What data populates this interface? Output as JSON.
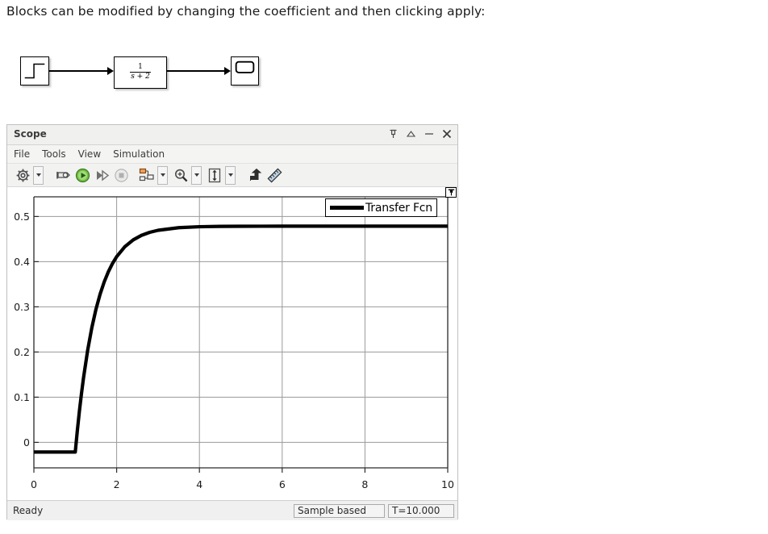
{
  "page": {
    "heading": "Blocks can be modified by changing the coefficient and then clicking apply:"
  },
  "model": {
    "step_block_name": "step-block",
    "transfer_fcn": {
      "numerator": "1",
      "denominator": "s + 2"
    },
    "scope_block_name": "scope-block"
  },
  "scope": {
    "title": "Scope",
    "window_controls": [
      {
        "name": "pin",
        "glyph": "⍠"
      },
      {
        "name": "undock",
        "glyph": "△"
      },
      {
        "name": "minimize",
        "glyph": "−"
      },
      {
        "name": "close",
        "glyph": "✕"
      }
    ],
    "menu": [
      {
        "label": "File"
      },
      {
        "label": "Tools"
      },
      {
        "label": "View"
      },
      {
        "label": "Simulation"
      }
    ],
    "toolbar": [
      {
        "name": "configuration-properties-icon",
        "has_dropdown": true
      },
      {
        "name": "print-icon",
        "has_dropdown": false
      },
      {
        "name": "run-icon",
        "has_dropdown": false
      },
      {
        "name": "step-forward-icon",
        "has_dropdown": false
      },
      {
        "name": "stop-icon",
        "has_dropdown": false
      },
      {
        "name": "layout-icon",
        "has_dropdown": true
      },
      {
        "name": "zoom-in-icon",
        "has_dropdown": true
      },
      {
        "name": "autoscale-icon",
        "has_dropdown": true
      },
      {
        "name": "bring-to-front-icon",
        "has_dropdown": false
      },
      {
        "name": "measurements-icon",
        "has_dropdown": false
      }
    ],
    "plot_pin_label": "⍠",
    "legend": {
      "label": "Transfer Fcn",
      "color": "#000000"
    },
    "statusbar": {
      "status": "Ready",
      "mode": "Sample based",
      "time": "T=10.000"
    }
  },
  "chart_data": {
    "type": "line",
    "title": "",
    "xlabel": "",
    "ylabel": "",
    "xlim": [
      0,
      10
    ],
    "ylim": [
      -0.035,
      0.565
    ],
    "xticks": [
      0,
      2,
      4,
      6,
      8,
      10
    ],
    "yticks": [
      0,
      0.1,
      0.2,
      0.3,
      0.4,
      0.5
    ],
    "xticklabels": [
      "0",
      "2",
      "4",
      "6",
      "8",
      "10"
    ],
    "yticklabels": [
      "0",
      "0.1",
      "0.2",
      "0.3",
      "0.4",
      "0.5"
    ],
    "grid": true,
    "legend_position": "upper right",
    "series": [
      {
        "name": "Transfer Fcn",
        "color": "#000000",
        "linewidth": 3,
        "x": [
          0,
          0.2,
          0.4,
          0.6,
          0.8,
          1.0,
          1.05,
          1.1,
          1.15,
          1.2,
          1.3,
          1.4,
          1.5,
          1.6,
          1.7,
          1.8,
          1.9,
          2.0,
          2.2,
          2.4,
          2.6,
          2.8,
          3.0,
          3.5,
          4.0,
          4.5,
          5.0,
          5.5,
          6.0,
          6.5,
          7.0,
          7.5,
          8.0,
          8.5,
          9.0,
          9.5,
          10.0
        ],
        "y": [
          0,
          0,
          0,
          0,
          0,
          0,
          0.0476,
          0.0906,
          0.1295,
          0.1648,
          0.2256,
          0.2753,
          0.3161,
          0.3495,
          0.3768,
          0.3992,
          0.4175,
          0.4325,
          0.4548,
          0.4697,
          0.4797,
          0.4864,
          0.4909,
          0.4967,
          0.4988,
          0.4996,
          0.4998,
          0.4999,
          0.5,
          0.5,
          0.5,
          0.5,
          0.5,
          0.5,
          0.5,
          0.5,
          0.5
        ]
      }
    ],
    "description": "First-order step response of 1/(s+2) to a unit step delayed by 1 s; steady-state value 0.5, time constant 0.5 s."
  }
}
